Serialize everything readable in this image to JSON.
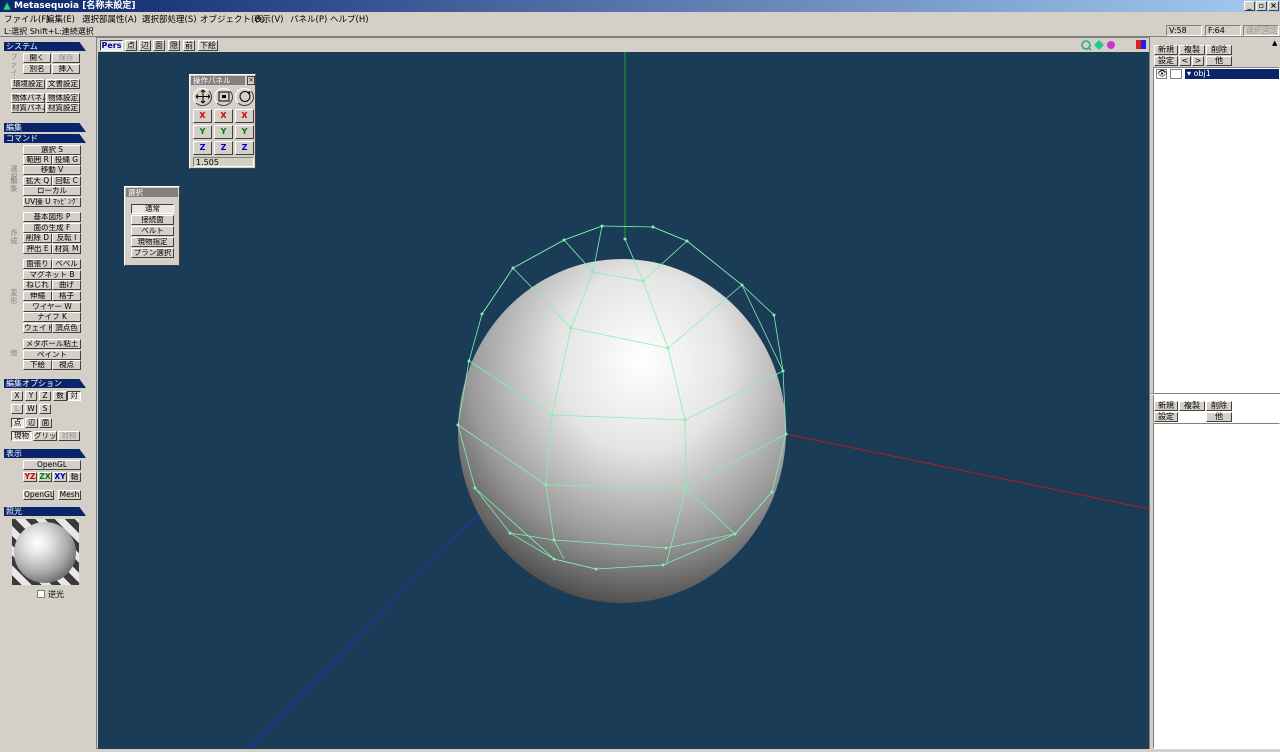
{
  "window": {
    "title": "Metasequoia [名称未設定]"
  },
  "menu": [
    "ファイル(F)",
    "編集(E)",
    "選択部属性(A)",
    "選択部処理(S)",
    "オブジェクト(O)",
    "表示(V)",
    "パネル(P)",
    "ヘルプ(H)"
  ],
  "status": {
    "hint": "L:選択  Shift+L:連続選択",
    "vertices": "V:58",
    "faces": "F:64",
    "selfix": "選択固定"
  },
  "left": {
    "system": {
      "header": "システム",
      "open": "開く",
      "save": "保存",
      "saveas": "別名",
      "insert": "挿入",
      "env": "環境設定",
      "docset": "文書設定",
      "objpanel": "物体パネル",
      "objset": "物体設定",
      "matpanel": "材質パネル",
      "matset": "材質設定",
      "vtag": "ファイル"
    },
    "edit_header": "編集",
    "command": {
      "header": "コマンド",
      "select": "選択 S",
      "range": "範囲 R",
      "lasso": "投縄 G",
      "move": "移動 V",
      "scale": "拡大 Q",
      "rotate": "回転 C",
      "local": "ローカル",
      "uvmap": "UV操 U ﾏｯﾋﾟﾝｸﾞ",
      "basic": "基本図形 P",
      "genface": "面の生成 F",
      "delete": "削除 D",
      "flip": "反転 I",
      "extrude": "押出 E",
      "material": "材質 M",
      "facecut": "面張り",
      "bevel": "ベベル",
      "magnet": "マグネット B",
      "twist": "ねじれ",
      "bend": "曲げ",
      "stretch": "伸縮",
      "lattice": "格子",
      "wire": "ワイヤー W",
      "knife": "ナイフ K",
      "weight": "ウェイト",
      "vcolor": "頂点色",
      "metaball": "メタボール粘土",
      "paint": "ペイント",
      "underlay": "下絵",
      "viewpoint": "視点",
      "tag1": "選択",
      "tag2": "編集",
      "tag3": "作成",
      "tag4": "変形",
      "tag5": "他"
    },
    "editopt": {
      "header": "編集オプション",
      "x": "X",
      "y": "Y",
      "z": "Z",
      "num": "数",
      "sym": "対",
      "l": "L",
      "w": "W",
      "s": "S",
      "pt": "点",
      "edge": "辺",
      "face": "面",
      "curobj": "現物",
      "grid": "グリッド",
      "symm": "対称"
    },
    "display": {
      "header": "表示",
      "opengl": "OpenGL",
      "yz": "YZ",
      "zx": "ZX",
      "xy": "XY",
      "axis": "軸",
      "opengl2": "OpenGL",
      "mesh": "Mesh"
    },
    "light": {
      "header": "照光",
      "backlight": "逆光"
    }
  },
  "viewport": {
    "tabs": [
      {
        "label": "Pers",
        "active": true
      },
      {
        "label": "点",
        "active": false
      },
      {
        "label": "辺",
        "active": false
      },
      {
        "label": "面",
        "active": false
      },
      {
        "label": "隠",
        "active": false
      },
      {
        "label": "前",
        "active": false
      },
      {
        "label": "下絵",
        "active": false
      }
    ],
    "bg_color": "#1a3c57",
    "wire_color": "#7ff2b0"
  },
  "opanel": {
    "title": "操作パネル",
    "x": "X",
    "y": "Y",
    "z": "Z",
    "value": "1.505"
  },
  "selpanel": {
    "title": "選択",
    "items": [
      "通常",
      "接続面",
      "ベルト",
      "現物指定",
      "プラン選択"
    ]
  },
  "right": {
    "top": {
      "new": "新規",
      "copy": "複製",
      "delete": "削除",
      "settings": "設定",
      "prev": "<",
      "next": ">",
      "other": "他"
    },
    "objects": [
      {
        "name": "obj1",
        "visible": true,
        "selected": true
      }
    ],
    "bottom": {
      "new": "新規",
      "copy": "複製",
      "delete": "削除",
      "settings": "設定",
      "other": "他"
    }
  }
}
